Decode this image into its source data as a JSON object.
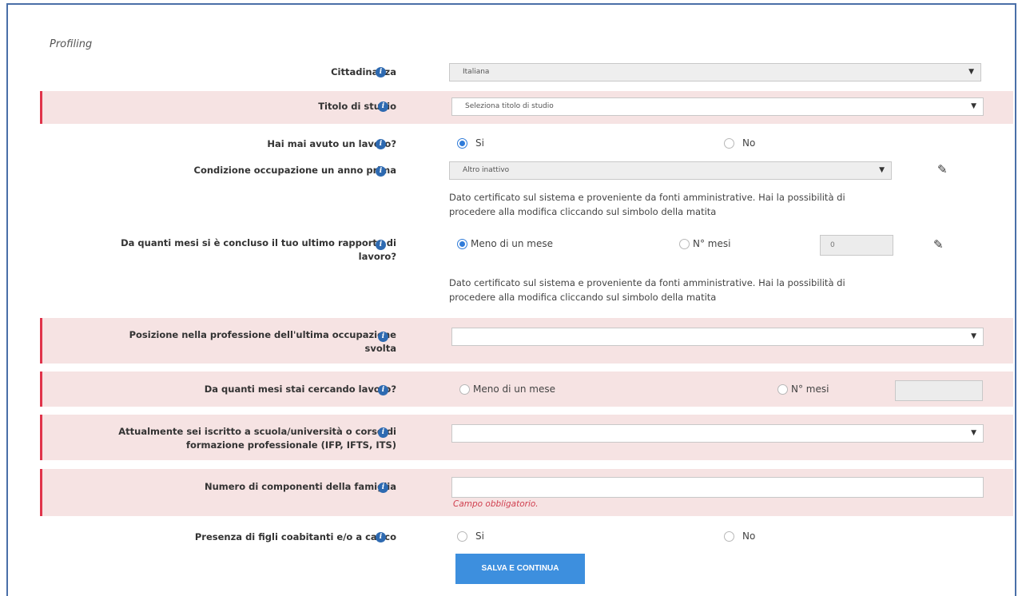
{
  "section_title": "Profiling",
  "fields": {
    "cittadinanza": {
      "label": "Cittadinanza",
      "value": "Italiana"
    },
    "titolo": {
      "label": "Titolo di studio",
      "placeholder": "Seleziona titolo di studio"
    },
    "lavoro": {
      "label": "Hai mai avuto un lavoro?",
      "opt_yes": "Si",
      "opt_no": "No"
    },
    "condizione": {
      "label": "Condizione occupazione un anno prima",
      "value": "Altro inattivo",
      "note_line1": "Dato certificato sul sistema e proveniente da fonti amministrative. Hai la possibilità di",
      "note_line2": "procedere alla modifica cliccando sul simbolo della matita"
    },
    "ultimo_rapporto": {
      "label_line1": "Da quanti mesi si è concluso il tuo ultimo rapporto di",
      "label_line2": "lavoro?",
      "opt_less": "Meno di un mese",
      "opt_months": "N° mesi",
      "months_value": "0",
      "note_line1": "Dato certificato sul sistema e proveniente da fonti amministrative. Hai la possibilità di",
      "note_line2": "procedere alla modifica cliccando sul simbolo della matita"
    },
    "posizione": {
      "label_line1": "Posizione nella professione dell'ultima occupazione",
      "label_line2": "svolta",
      "value": ""
    },
    "cercando": {
      "label": "Da quanti mesi stai cercando lavoro?",
      "opt_less": "Meno di un mese",
      "opt_months": "N° mesi",
      "months_value": ""
    },
    "iscritto": {
      "label_line1": "Attualmente sei iscritto a scuola/università o corso di",
      "label_line2": "formazione professionale (IFP, IFTS, ITS)",
      "value": ""
    },
    "famiglia": {
      "label": "Numero di componenti della famiglia",
      "value": "",
      "error": "Campo obbligatorio."
    },
    "figli": {
      "label": "Presenza di figli coabitanti e/o a carico",
      "opt_yes": "Si",
      "opt_no": "No"
    }
  },
  "submit_label": "SALVA E CONTINUA",
  "icons": {
    "info": "info-icon",
    "pencil": "pencil-icon",
    "caret": "chevron-down-icon"
  },
  "colors": {
    "required_bar": "#e0344b",
    "required_bg": "#f6e3e3",
    "accent": "#3d8fde",
    "info": "#2e6ab1"
  }
}
